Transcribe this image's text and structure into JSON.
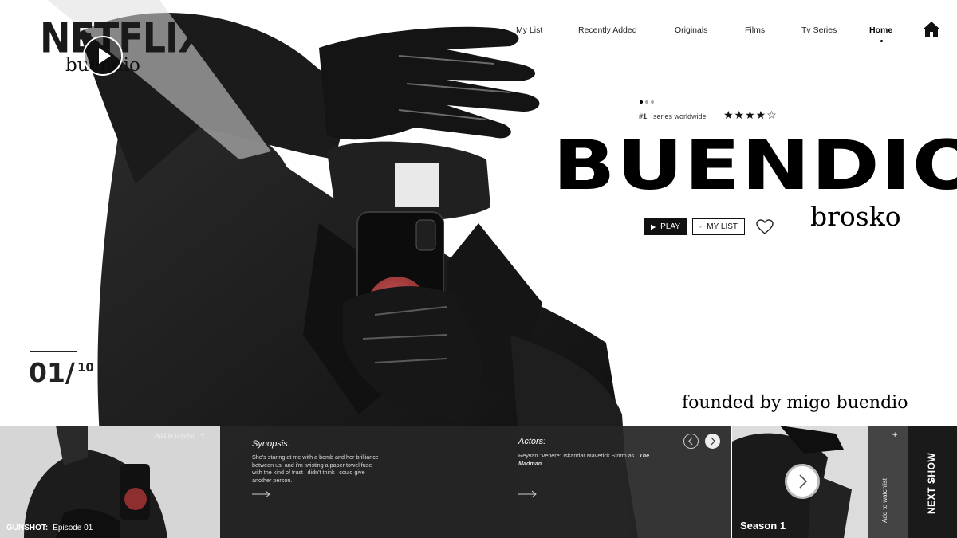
{
  "brand": {
    "logo": "NETFLIX",
    "sub": "buendio"
  },
  "nav": {
    "items": [
      {
        "label": "My List",
        "active": false
      },
      {
        "label": "Recently Added",
        "active": false
      },
      {
        "label": "Originals",
        "active": false
      },
      {
        "label": "Films",
        "active": false
      },
      {
        "label": "Tv Series",
        "active": false
      },
      {
        "label": "Home",
        "active": true
      }
    ],
    "home_icon": "home-icon"
  },
  "feature": {
    "rank": "#1",
    "rank_text": "series worldwide",
    "rating": 4.5,
    "stars": "★★★★☆",
    "title": "BUENDIO",
    "subtitle": "brosko",
    "play_label": "PLAY",
    "mylist_label": "MY LIST",
    "founded": "founded by migo buendio"
  },
  "counter": {
    "current": "01/",
    "total": "10"
  },
  "episode_card": {
    "add_playlist": "Add to playlist",
    "show": "GUNSHOT:",
    "episode": "Episode 01"
  },
  "synopsis": {
    "heading": "Synopsis:",
    "text": "She's staring at me with a bomb and her brilliance between us, and i'm twisting a paper towel fuse with the kind of trust i didn't think i could give another person."
  },
  "actors": {
    "heading": "Actors:",
    "text": "Reyvan \"Venere\" Iskandar Maverick Storm as",
    "role": "The Madman"
  },
  "season": {
    "label": "Season 1",
    "watchlist": "Add to watchlist",
    "next": "NEXT SHOW"
  },
  "colors": {
    "panel": "#262626",
    "accent": "#b03a3a",
    "text": "#111111"
  }
}
